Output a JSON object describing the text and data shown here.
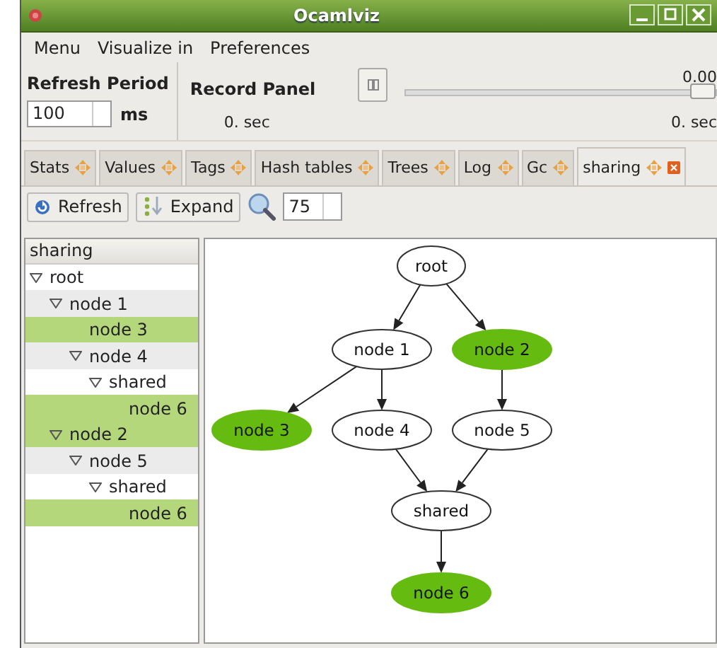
{
  "window": {
    "title": "Ocamlviz"
  },
  "menu": [
    "Menu",
    "Visualize in",
    "Preferences"
  ],
  "refresh_period": {
    "label": "Refresh Period",
    "value": "100",
    "unit": "ms"
  },
  "record_panel": {
    "label": "Record Panel",
    "start_time": "0. sec",
    "end_value": "0.00",
    "end_time": "0. sec",
    "slider": {
      "level": 1
    }
  },
  "tabs": [
    {
      "label": "Stats",
      "selected": false,
      "closable": false
    },
    {
      "label": "Values",
      "selected": false,
      "closable": false
    },
    {
      "label": "Tags",
      "selected": false,
      "closable": false
    },
    {
      "label": "Hash tables",
      "selected": false,
      "closable": false
    },
    {
      "label": "Trees",
      "selected": false,
      "closable": false
    },
    {
      "label": "Log",
      "selected": false,
      "closable": false
    },
    {
      "label": "Gc",
      "selected": false,
      "closable": false
    },
    {
      "label": "sharing",
      "selected": true,
      "closable": true
    }
  ],
  "toolbar": {
    "buttons": [
      {
        "label": "Refresh",
        "kind": "refresh"
      },
      {
        "label": "Expand",
        "kind": "expand"
      }
    ],
    "zoom": "75"
  },
  "tree": {
    "header": "sharing",
    "items": [
      {
        "label": "root",
        "highlighted": false,
        "expanded": true,
        "children": [
          {
            "label": "node 1",
            "highlighted": false,
            "expanded": true,
            "children": [
              {
                "label": "node 3",
                "highlighted": true
              },
              {
                "label": "node 4",
                "highlighted": false,
                "expanded": true,
                "children": [
                  {
                    "label": "shared",
                    "highlighted": false,
                    "expanded": true,
                    "children": [
                      {
                        "label": "node 6",
                        "highlighted": true
                      }
                    ]
                  }
                ]
              }
            ]
          },
          {
            "label": "node 2",
            "highlighted": true,
            "expanded": true,
            "children": [
              {
                "label": "node 5",
                "highlighted": false,
                "expanded": true,
                "children": [
                  {
                    "label": "shared",
                    "highlighted": false,
                    "expanded": true,
                    "children": [
                      {
                        "label": "node 6",
                        "highlighted": true
                      }
                    ]
                  }
                ]
              }
            ]
          }
        ]
      }
    ]
  },
  "graph": {
    "nodes": [
      {
        "label": "root",
        "highlighted": false
      },
      {
        "label": "node 1",
        "highlighted": false
      },
      {
        "label": "node 2",
        "highlighted": true
      },
      {
        "label": "node 3",
        "highlighted": true
      },
      {
        "label": "node 4",
        "highlighted": false
      },
      {
        "label": "node 5",
        "highlighted": false
      },
      {
        "label": "shared",
        "highlighted": false
      },
      {
        "label": "node 6",
        "highlighted": true
      }
    ]
  }
}
